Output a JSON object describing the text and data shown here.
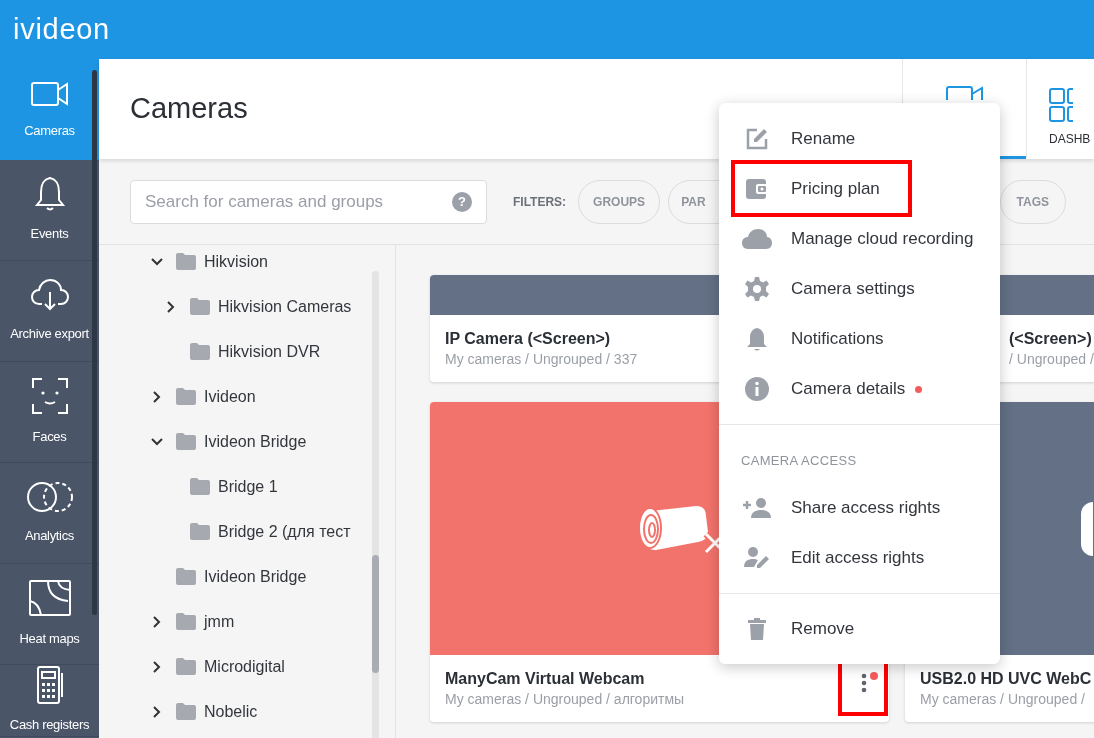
{
  "app": {
    "logo": "ivideon"
  },
  "nav": [
    {
      "label": "Cameras",
      "selected": true
    },
    {
      "label": "Events",
      "selected": false
    },
    {
      "label": "Archive export",
      "selected": false
    },
    {
      "label": "Faces",
      "selected": false
    },
    {
      "label": "Analytics",
      "selected": false
    },
    {
      "label": "Heat maps",
      "selected": false
    },
    {
      "label": "Cash registers",
      "selected": false
    }
  ],
  "page": {
    "title": "Cameras"
  },
  "view_tabs": [
    {
      "selected": true
    },
    {
      "label": "DASHB",
      "selected": false
    }
  ],
  "search": {
    "placeholder": "Search for cameras and groups",
    "help": "?"
  },
  "filters": {
    "label": "FILTERS:",
    "chips": [
      "GROUPS",
      "PAR",
      "TAGS"
    ]
  },
  "tree": [
    {
      "label": "Hikvision",
      "expanded": true,
      "children": [
        {
          "label": "Hikvision Cameras",
          "expanded": false,
          "has_children": true
        },
        {
          "label": "Hikvision DVR"
        }
      ]
    },
    {
      "label": "Ivideon",
      "expanded": false,
      "has_children": true
    },
    {
      "label": "Ivideon Bridge",
      "expanded": true,
      "children": [
        {
          "label": "Bridge 1"
        },
        {
          "label": "Bridge 2 (для тест"
        }
      ]
    },
    {
      "label": "Ivideon Bridge"
    },
    {
      "label": "jmm",
      "expanded": false,
      "has_children": true
    },
    {
      "label": "Microdigital",
      "expanded": false,
      "has_children": true
    },
    {
      "label": "Nobelic",
      "expanded": false,
      "has_children": true
    }
  ],
  "cards": [
    {
      "title": "IP Camera (<Screen>)",
      "path": "My cameras / Ungrouped / 337",
      "offline": false
    },
    {
      "title": "(<Screen>)",
      "path": "/ Ungrouped /",
      "offline": false
    },
    {
      "title": "ManyCam Virtual Webcam",
      "path": "My cameras / Ungrouped / алгоритмы",
      "offline": true,
      "menu_open": true,
      "notice_dot": true,
      "highlighted": true
    },
    {
      "title": "USB2.0 HD UVC WebC",
      "path": "My cameras / Ungrouped /",
      "offline": false,
      "play": true
    }
  ],
  "menu": [
    {
      "items": [
        {
          "label": "Rename",
          "highlighted": false
        },
        {
          "label": "Pricing plan",
          "highlighted": true
        },
        {
          "label": "Manage cloud recording",
          "highlighted": false
        },
        {
          "label": "Camera settings",
          "highlighted": false
        },
        {
          "label": "Notifications",
          "highlighted": false
        },
        {
          "label": "Camera details",
          "highlighted": false,
          "dot": true
        }
      ]
    },
    {
      "heading": "CAMERA ACCESS",
      "items": [
        {
          "label": "Share access rights",
          "highlighted": false
        },
        {
          "label": "Edit access rights",
          "highlighted": false
        }
      ]
    },
    {
      "items": [
        {
          "label": "Remove",
          "highlighted": false
        }
      ]
    }
  ]
}
